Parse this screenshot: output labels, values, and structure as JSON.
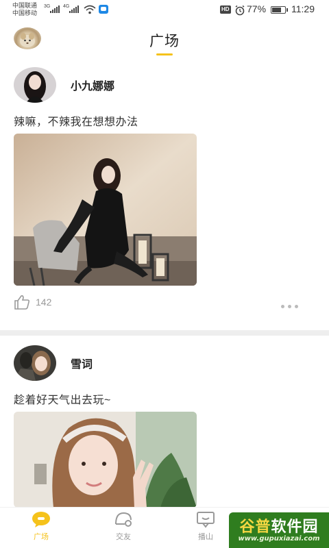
{
  "status_bar": {
    "carrier_1": "中国联通",
    "carrier_2": "中国移动",
    "network_1": "3G",
    "network_2": "4G",
    "hd_badge": "HD",
    "battery_percent": "77%",
    "battery_level": 0.77,
    "time": "11:29",
    "icons": [
      "signal-icon",
      "signal-icon",
      "wifi-icon",
      "app-notification-icon",
      "alarm-icon",
      "battery-icon"
    ]
  },
  "header": {
    "title": "广场",
    "accent_color": "#f5c21b"
  },
  "posts": [
    {
      "author": "小九娜娜",
      "text": "辣嘛，不辣我在想想办法",
      "likes": "142",
      "image": "woman-in-black-lace-dress-photo"
    },
    {
      "author": "雪词",
      "text": "趁着好天气出去玩~",
      "image": "girl-with-headband-peace-sign-photo"
    }
  ],
  "bottom_nav": {
    "items": [
      {
        "label": "广场",
        "icon": "plaza-icon",
        "active": true
      },
      {
        "label": "交友",
        "icon": "friends-icon",
        "active": false
      },
      {
        "label": "播山",
        "icon": "broadcast-icon",
        "active": false
      }
    ]
  },
  "watermark": {
    "brand_part_1": "谷普",
    "brand_part_2": "软件园",
    "url": "www.gupuxiazai.com"
  }
}
